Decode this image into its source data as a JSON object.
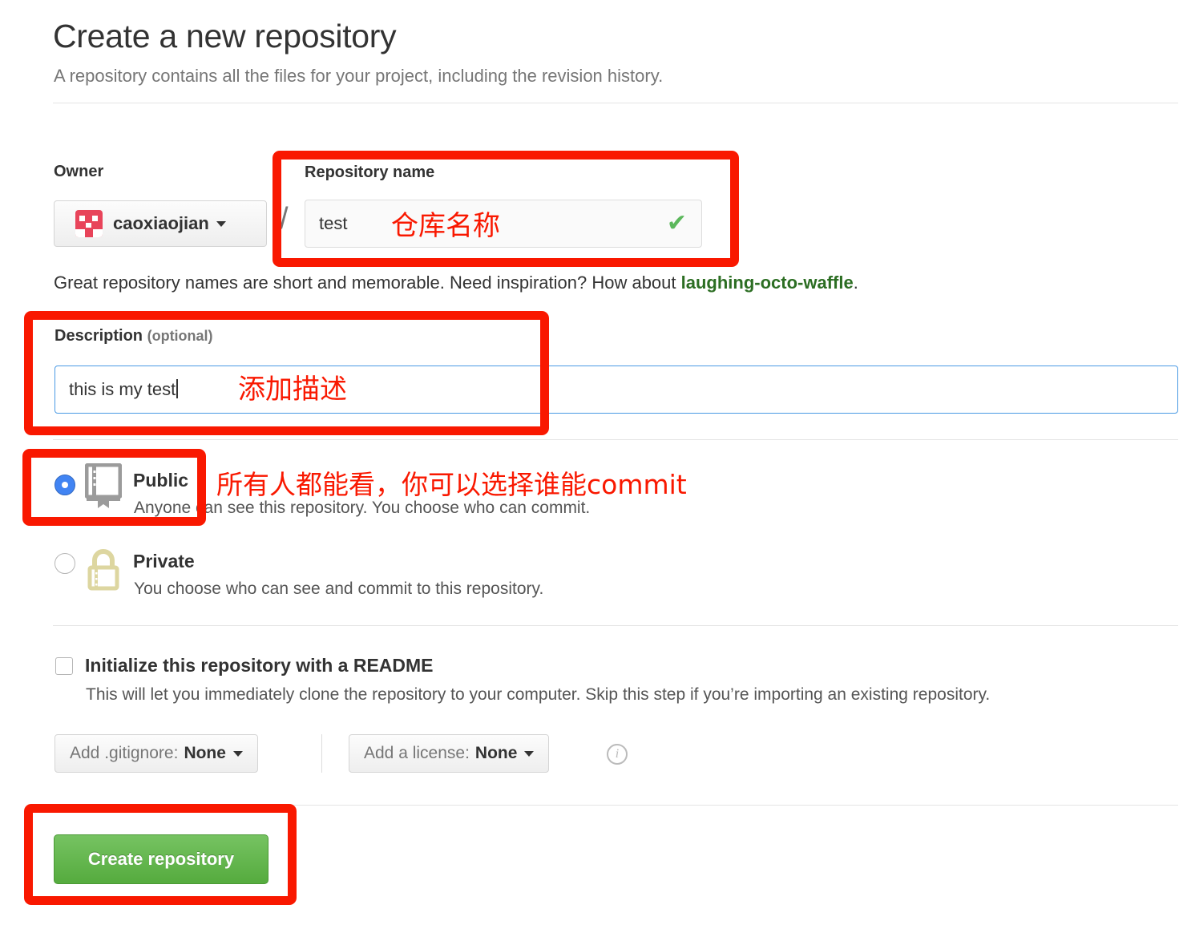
{
  "page": {
    "title": "Create a new repository",
    "subtitle": "A repository contains all the files for your project, including the revision history."
  },
  "owner": {
    "label": "Owner",
    "name": "caoxiaojian",
    "separator": "/",
    "avatar_color": "#e8445a"
  },
  "repository_name": {
    "label": "Repository name",
    "value": "test",
    "placeholder": "",
    "valid_mark": "✔"
  },
  "hint": {
    "prefix": "Great repository names are short and memorable. Need inspiration? How about ",
    "suggestion": "laughing-octo-waffle",
    "suffix": ".",
    "suggestion_color": "#2c6e23"
  },
  "description": {
    "label": "Description ",
    "optional": "(optional)",
    "value": "this is my test",
    "placeholder": ""
  },
  "visibility": {
    "public": {
      "title": "Public",
      "description": "Anyone can see this repository. You choose who can commit.",
      "selected": true,
      "icon": "repo-book-icon"
    },
    "private": {
      "title": "Private",
      "description": "You choose who can see and commit to this repository.",
      "selected": false,
      "icon": "lock-icon"
    }
  },
  "readme": {
    "label": "Initialize this repository with a README",
    "description": "This will let you immediately clone the repository to your computer. Skip this step if you’re importing an existing repository.",
    "checked": false
  },
  "dropdowns": {
    "gitignore": {
      "lead": "Add .gitignore:",
      "selected": "None"
    },
    "license": {
      "lead": "Add a license:",
      "selected": "None"
    },
    "info_icon": "info-icon",
    "info_glyph": "i"
  },
  "submit": {
    "label": "Create repository",
    "color": "#55ab3e"
  },
  "annotations": {
    "color": "#f91800",
    "repo_name_text": "仓库名称",
    "description_text": "添加描述",
    "public_text": "所有人都能看，你可以选择谁能commit"
  }
}
